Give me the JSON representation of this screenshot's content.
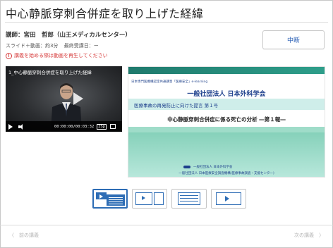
{
  "page": {
    "title": "中心静脈穿刺合併症を取り上げた経緯"
  },
  "lecture": {
    "lecturer": "講師：宮田　哲郎（山王メディカルセンター）",
    "format": "スライド＋動画：約3分",
    "last_attended": "最終受講日：ー",
    "warning": "講義を始める際は動画を再生してください",
    "warning_icon": "exclamation-icon"
  },
  "buttons": {
    "stop": "中断"
  },
  "video": {
    "title": "1_中心静脈穿刺合併症を取り上げた経緯",
    "time": "00:00:00/00:03:32",
    "speed": "2Sp",
    "progress": 0
  },
  "slide": {
    "header_small": "日本専門医機構認定共通講習「医療安全」e-learning",
    "organization": "一般社団法人 日本外科学会",
    "subtitle": "医療事故の再発防止に向けた提言 第１号",
    "main_title": "中心静脈穿刺合併症に係る死亡の分析 ―第１報―",
    "logo_text": "一般社団法人 日本外科学会",
    "footer": "一般社団法人 日本医療安全調査機構(医療事故調査・支援センター)"
  },
  "layout_options": [
    {
      "name": "video-slide-layout",
      "active": true
    },
    {
      "name": "video-only-layout",
      "active": false
    },
    {
      "name": "slide-only-layout",
      "active": false
    },
    {
      "name": "video-large-layout",
      "active": false
    }
  ],
  "nav": {
    "prev": "〈　前の講義",
    "next": "次の講義　〉"
  },
  "colors": {
    "accent": "#2e6db5",
    "warning": "#d63a3a",
    "slide_teal": "#9fdcc9"
  }
}
